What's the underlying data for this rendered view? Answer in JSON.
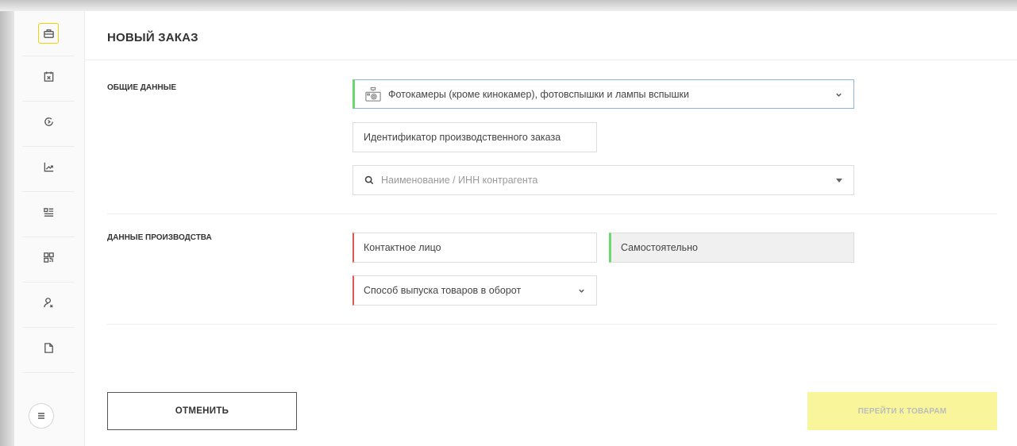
{
  "page": {
    "title": "НОВЫЙ ЗАКАЗ"
  },
  "sidebar": {
    "items": [
      {
        "icon": "briefcase-icon",
        "active": true
      },
      {
        "icon": "calendar-x-icon",
        "active": false
      },
      {
        "icon": "refresh-circle-icon",
        "active": false
      },
      {
        "icon": "chart-up-icon",
        "active": false
      },
      {
        "icon": "list-doc-icon",
        "active": false
      },
      {
        "icon": "qr-code-icon",
        "active": false
      },
      {
        "icon": "user-icon",
        "active": false
      },
      {
        "icon": "file-icon",
        "active": false
      }
    ],
    "menu_icon": "hamburger-icon"
  },
  "general": {
    "label": "ОБЩИЕ ДАННЫЕ",
    "category_value": "Фотокамеры (кроме кинокамер), фотовспышки и лампы вспышки",
    "category_icon": "camera-icon",
    "order_id_placeholder": "Идентификатор производственного заказа",
    "contractor_placeholder": "Наименование / ИНН контрагента"
  },
  "production": {
    "label": "ДАННЫЕ ПРОИЗВОДСТВА",
    "contact_placeholder": "Контактное лицо",
    "mode_value": "Самостоятельно",
    "release_method_placeholder": "Способ выпуска товаров в оборот"
  },
  "actions": {
    "cancel_label": "ОТМЕНИТЬ",
    "next_label": "ПЕРЕЙТИ К ТОВАРАМ"
  },
  "colors": {
    "accent_yellow": "#f9f59a",
    "valid_green": "#6cd96c",
    "error_red": "#e05555"
  }
}
